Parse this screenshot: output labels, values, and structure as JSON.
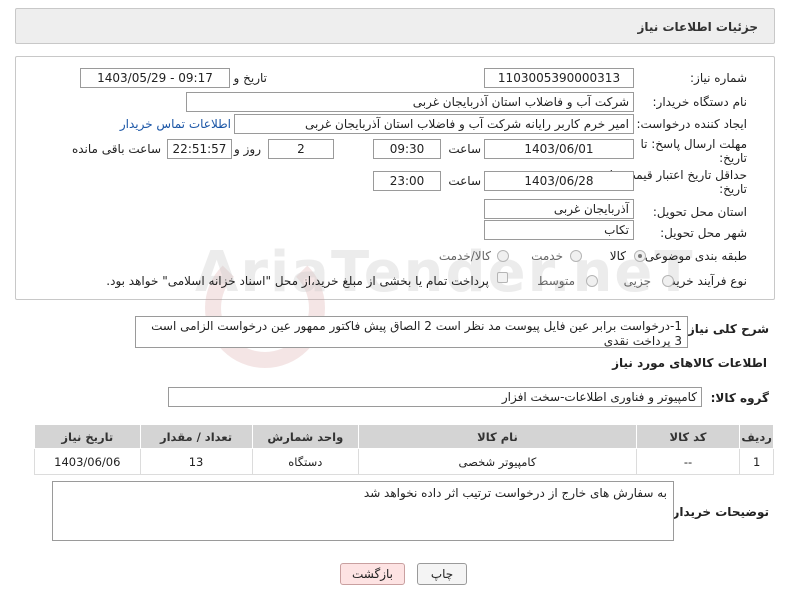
{
  "header": {
    "title": "جزئیات اطلاعات نیاز"
  },
  "form": {
    "need_number_label": "شماره نیاز:",
    "need_number": "1103005390000313",
    "announce_label": "تاریخ و ساعت اعلان عمومی:",
    "announce_value": "1403/05/29 - 09:17",
    "buyer_label": "نام دستگاه خریدار:",
    "buyer_value": "شرکت آب و فاضلاب استان آذربایجان غربی",
    "creator_label": "ایجاد کننده درخواست:",
    "creator_value": "امیر خرم کاربر رایانه شرکت آب و فاضلاب استان آذربایجان غربی",
    "contact_link": "اطلاعات تماس خریدار",
    "deadline_label_1": "مهلت ارسال پاسخ: تا",
    "deadline_label_2": "تاریخ:",
    "deadline_date": "1403/06/01",
    "time_label": "ساعت",
    "deadline_time": "09:30",
    "days_value": "2",
    "days_label": "روز و",
    "remaining_value": "22:51:57",
    "remaining_label": "ساعت باقی مانده",
    "min_validity_label_1": "حداقل تاریخ اعتبار قیمت: تا",
    "min_validity_label_2": "تاریخ:",
    "validity_date": "1403/06/28",
    "validity_time": "23:00",
    "province_label": "استان محل تحویل:",
    "province_value": "آذربایجان غربی",
    "city_label": "شهر محل تحویل:",
    "city_value": "تکاب",
    "category_label": "طبقه بندی موضوعی:",
    "category_options": [
      "کالا",
      "خدمت",
      "کالا/خدمت"
    ],
    "process_label": "نوع فرآیند خرید :",
    "process_options": [
      "جزیی",
      "متوسط"
    ],
    "payment_note": "پرداخت تمام یا بخشی از مبلغ خرید،از محل \"اسناد خزانه اسلامی\" خواهد بود."
  },
  "description": {
    "label": "شرح کلی نیاز:",
    "text": "1-درخواست برابر عین فایل پیوست مد نظر است 2 الصاق پیش فاکتور ممهور عین درخواست الزامی است 3 پرداخت نقدی"
  },
  "goods": {
    "section_title": "اطلاعات کالاهای مورد نیاز",
    "group_label": "گروه کالا:",
    "group_value": "کامپیوتر و فناوری اطلاعات-سخت افزار",
    "columns": [
      "ردیف",
      "کد کالا",
      "نام کالا",
      "واحد شمارش",
      "تعداد / مقدار",
      "تاریخ نیاز"
    ],
    "rows": [
      [
        "1",
        "--",
        "کامپیوتر شخصی",
        "دستگاه",
        "13",
        "1403/06/06"
      ]
    ]
  },
  "buyer_notes": {
    "label": "توضیحات خریدار:",
    "text": "به سفارش های خارج از درخواست ترتیب اثر داده نخواهد شد"
  },
  "buttons": {
    "print": "چاپ",
    "back": "بازگشت"
  },
  "watermark": "AriaTender.neT"
}
